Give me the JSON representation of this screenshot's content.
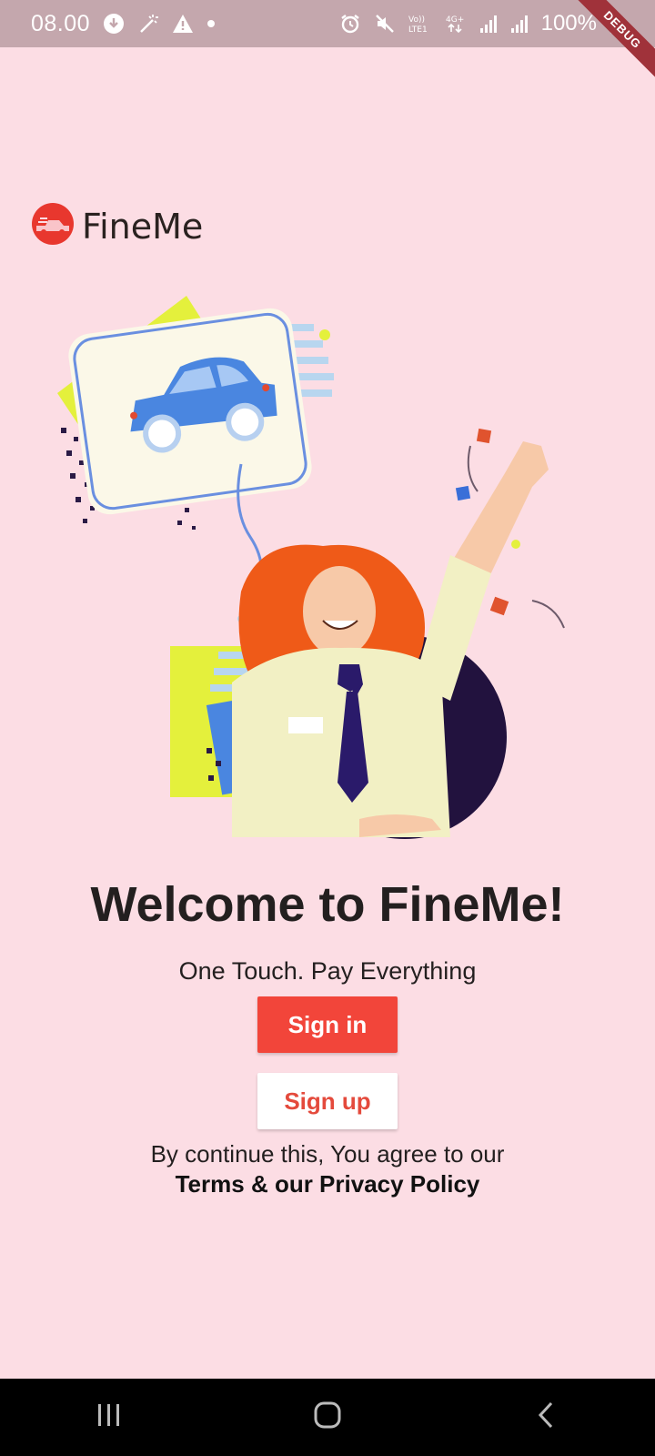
{
  "status_bar": {
    "time": "08.00",
    "battery": "100%",
    "icons": [
      "download-icon",
      "magic-wand-icon",
      "warning-icon",
      "dot-icon",
      "alarm-icon",
      "mute-icon",
      "volte-icon",
      "4g-icon",
      "signal-icon",
      "signal-icon",
      "battery-icon"
    ]
  },
  "debug_banner": "DEBUG",
  "app": {
    "logo_name": "FineMe",
    "brand_color": "#f2453a"
  },
  "welcome": {
    "title": "Welcome to FineMe!",
    "tagline": "One Touch. Pay Everything"
  },
  "buttons": {
    "sign_in": "Sign in",
    "sign_up": "Sign up"
  },
  "terms": {
    "line1": "By continue this, You agree to our",
    "line2": "Terms & our Privacy Policy"
  },
  "nav_bar": {
    "icons": [
      "recent-apps-icon",
      "home-icon",
      "back-icon"
    ]
  }
}
